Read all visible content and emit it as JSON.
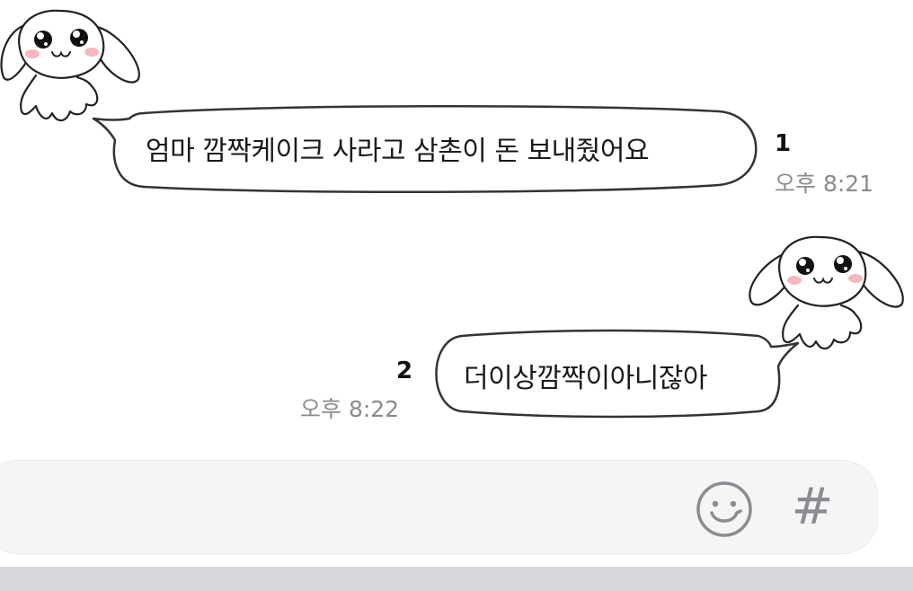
{
  "messages": [
    {
      "direction": "received",
      "text": "엄마 깜짝케이크 사라고 삼촌이 돈 보내줬어요",
      "unread_count": "1",
      "time": "오후 8:21",
      "sticker": "bunny-sticker"
    },
    {
      "direction": "sent",
      "text": "더이상깜짝이아니잖아",
      "unread_count": "2",
      "time": "오후 8:22",
      "sticker": "bunny-sticker"
    }
  ],
  "composer": {
    "value": "",
    "placeholder": "",
    "emoji_icon": "smiley-face-icon",
    "hash_icon": "#"
  },
  "colors": {
    "bubble_fill": "#ffffff",
    "bubble_stroke": "#333333",
    "time_text": "#8b8b8b",
    "composer_bg": "#f5f5f5",
    "icon_gray": "#8a8c91",
    "bottom_strip": "#d6d7dd",
    "blush": "#f7b8bd"
  }
}
